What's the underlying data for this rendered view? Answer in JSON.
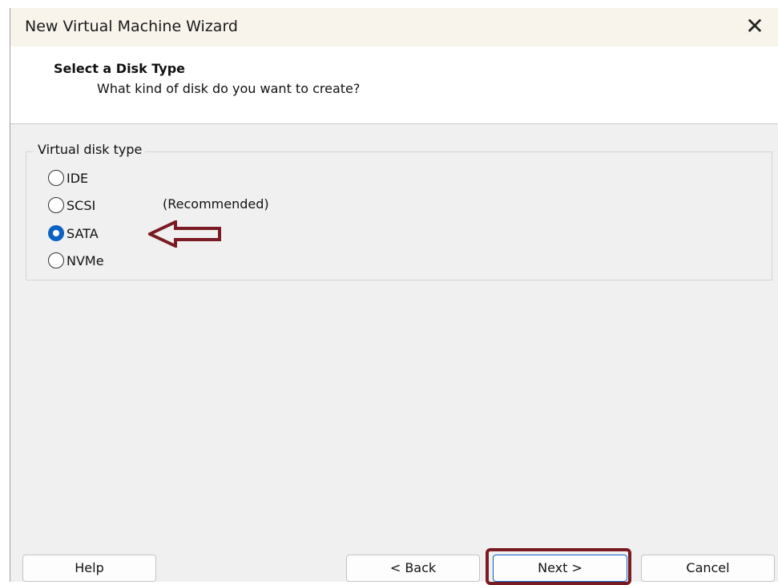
{
  "window": {
    "title": "New Virtual Machine Wizard",
    "close_symbol": "✕"
  },
  "header": {
    "title": "Select a Disk Type",
    "subtitle": "What kind of disk do you want to create?"
  },
  "disk_type": {
    "group_label": "Virtual disk type",
    "selected": "SATA",
    "options": [
      {
        "label": "IDE",
        "note": "",
        "checked": false
      },
      {
        "label": "SCSI",
        "note": "(Recommended)",
        "checked": false
      },
      {
        "label": "SATA",
        "note": "",
        "checked": true
      },
      {
        "label": "NVMe",
        "note": "",
        "checked": false
      }
    ]
  },
  "footer": {
    "help_label": "Help",
    "back_label": "< Back",
    "next_label": "Next >",
    "cancel_label": "Cancel"
  },
  "annotations": {
    "arrow_icon": "left-arrow-icon",
    "color": "#7a1a22"
  },
  "colors": {
    "accent": "#0a62c2",
    "title_bar": "#f8f4ec",
    "panel": "#f0f0f0"
  }
}
